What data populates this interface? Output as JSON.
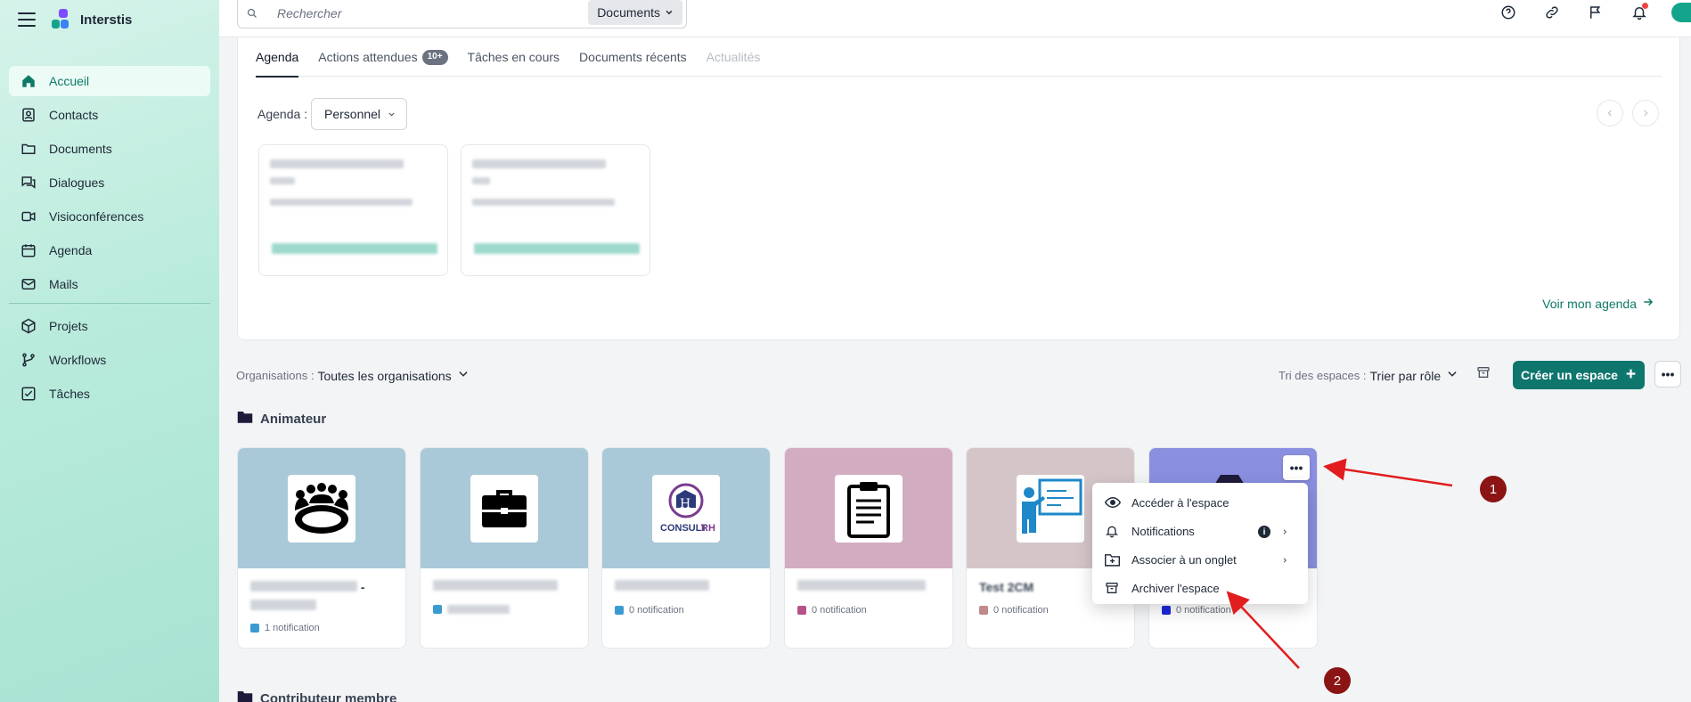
{
  "app": {
    "name": "Interstis"
  },
  "colors": {
    "accent": "#0f766e",
    "active_nav": "#0d7a66",
    "annotation": "#8b1414"
  },
  "sidebar": {
    "items": [
      {
        "label": "Accueil",
        "icon": "home-icon"
      },
      {
        "label": "Contacts",
        "icon": "contacts-icon"
      },
      {
        "label": "Documents",
        "icon": "folder-icon"
      },
      {
        "label": "Dialogues",
        "icon": "chat-icon"
      },
      {
        "label": "Visioconférences",
        "icon": "video-icon"
      },
      {
        "label": "Agenda",
        "icon": "calendar-icon"
      },
      {
        "label": "Mails",
        "icon": "mail-icon"
      },
      {
        "label": "Projets",
        "icon": "cube-icon"
      },
      {
        "label": "Workflows",
        "icon": "branch-icon"
      },
      {
        "label": "Tâches",
        "icon": "checkbox-icon"
      }
    ]
  },
  "search": {
    "placeholder": "Rechercher",
    "scope": "Documents"
  },
  "tabs": [
    {
      "label": "Agenda"
    },
    {
      "label": "Actions attendues",
      "badge": "10+"
    },
    {
      "label": "Tâches en cours"
    },
    {
      "label": "Documents récents"
    },
    {
      "label": "Actualités"
    }
  ],
  "agenda": {
    "label": "Agenda :",
    "selected": "Personnel",
    "link": "Voir mon agenda"
  },
  "filters": {
    "org_label": "Organisations :",
    "org_value": "Toutes les organisations",
    "sort_label": "Tri des espaces :",
    "sort_value": "Trier par rôle",
    "create_label": "Créer un espace"
  },
  "sections": {
    "animateur": "Animateur",
    "contributeur": "Contributeur membre"
  },
  "spaces": [
    {
      "name": "",
      "notif": "1 notification",
      "color": "#a9c9d8",
      "dot": "#3b9bd1"
    },
    {
      "name": "",
      "notif": "",
      "color": "#a9c9d8",
      "dot": "#3b9bd1"
    },
    {
      "name": "",
      "notif": "0 notification",
      "color": "#a9c9d8",
      "dot": "#3b9bd1"
    },
    {
      "name": "",
      "notif": "0 notification",
      "color": "#d2adc2",
      "dot": "#b8508a"
    },
    {
      "name": "Test 2CM",
      "notif": "0 notification",
      "color": "#d4c6c8",
      "dot": "#c08a8a"
    },
    {
      "name": "",
      "notif": "0 notification",
      "color": "#8a8fe0",
      "dot": "#1d27d8"
    }
  ],
  "context_menu": [
    {
      "label": "Accéder à l'espace",
      "icon": "eye-icon"
    },
    {
      "label": "Notifications",
      "icon": "bell-icon"
    },
    {
      "label": "Associer à un onglet",
      "icon": "folder-plus-icon"
    },
    {
      "label": "Archiver l'espace",
      "icon": "archive-icon"
    }
  ],
  "annotations": [
    "1",
    "2"
  ]
}
